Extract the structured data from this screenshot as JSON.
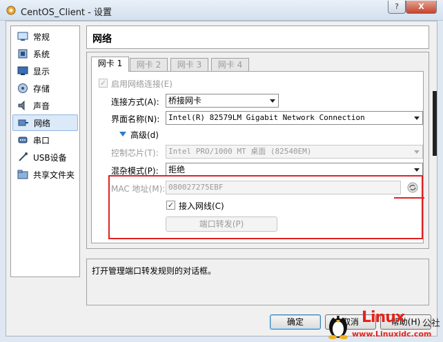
{
  "window": {
    "title": "CentOS_Client - 设置",
    "help_label": "?",
    "close_label": "X"
  },
  "sidebar": {
    "items": [
      {
        "label": "常规",
        "icon": "general-icon"
      },
      {
        "label": "系统",
        "icon": "system-icon"
      },
      {
        "label": "显示",
        "icon": "display-icon"
      },
      {
        "label": "存储",
        "icon": "storage-icon"
      },
      {
        "label": "声音",
        "icon": "audio-icon"
      },
      {
        "label": "网络",
        "icon": "network-icon",
        "selected": true
      },
      {
        "label": "串口",
        "icon": "serial-port-icon"
      },
      {
        "label": "USB设备",
        "icon": "usb-icon"
      },
      {
        "label": "共享文件夹",
        "icon": "shared-folder-icon"
      }
    ]
  },
  "panel": {
    "title": "网络",
    "tabs": [
      "网卡 1",
      "网卡 2",
      "网卡 3",
      "网卡 4"
    ],
    "active_tab": 0
  },
  "adapter": {
    "enable_label": "启用网络连接(E)",
    "enable_checked": true,
    "attached_label": "连接方式(A):",
    "attached_value": "桥接网卡",
    "name_label": "界面名称(N):",
    "name_value": "Intel(R) 82579LM Gigabit Network Connection",
    "advanced_label": "高级(d)",
    "chip_label": "控制芯片(T):",
    "chip_value": "Intel PRO/1000 MT 桌面 (82540EM)",
    "promisc_label": "混杂模式(P):",
    "promisc_value": "拒绝",
    "mac_label": "MAC 地址(M):",
    "mac_value": "080027275EBF",
    "cable_label": "接入网线(C)",
    "cable_checked": true,
    "port_forward_label": "端口转发(P)"
  },
  "description": {
    "text": "打开管理端口转发规则的对话框。"
  },
  "footer": {
    "ok_label": "确定",
    "cancel_label": "取消",
    "help_label": "帮助(H)"
  },
  "watermark": {
    "logo": "Linux",
    "cn": "公社",
    "url": "www.Linuxidc.com"
  },
  "colors": {
    "highlight_box": "#e02020",
    "selected_bg": "#dbe9f9",
    "watermark": "#e3231b"
  }
}
